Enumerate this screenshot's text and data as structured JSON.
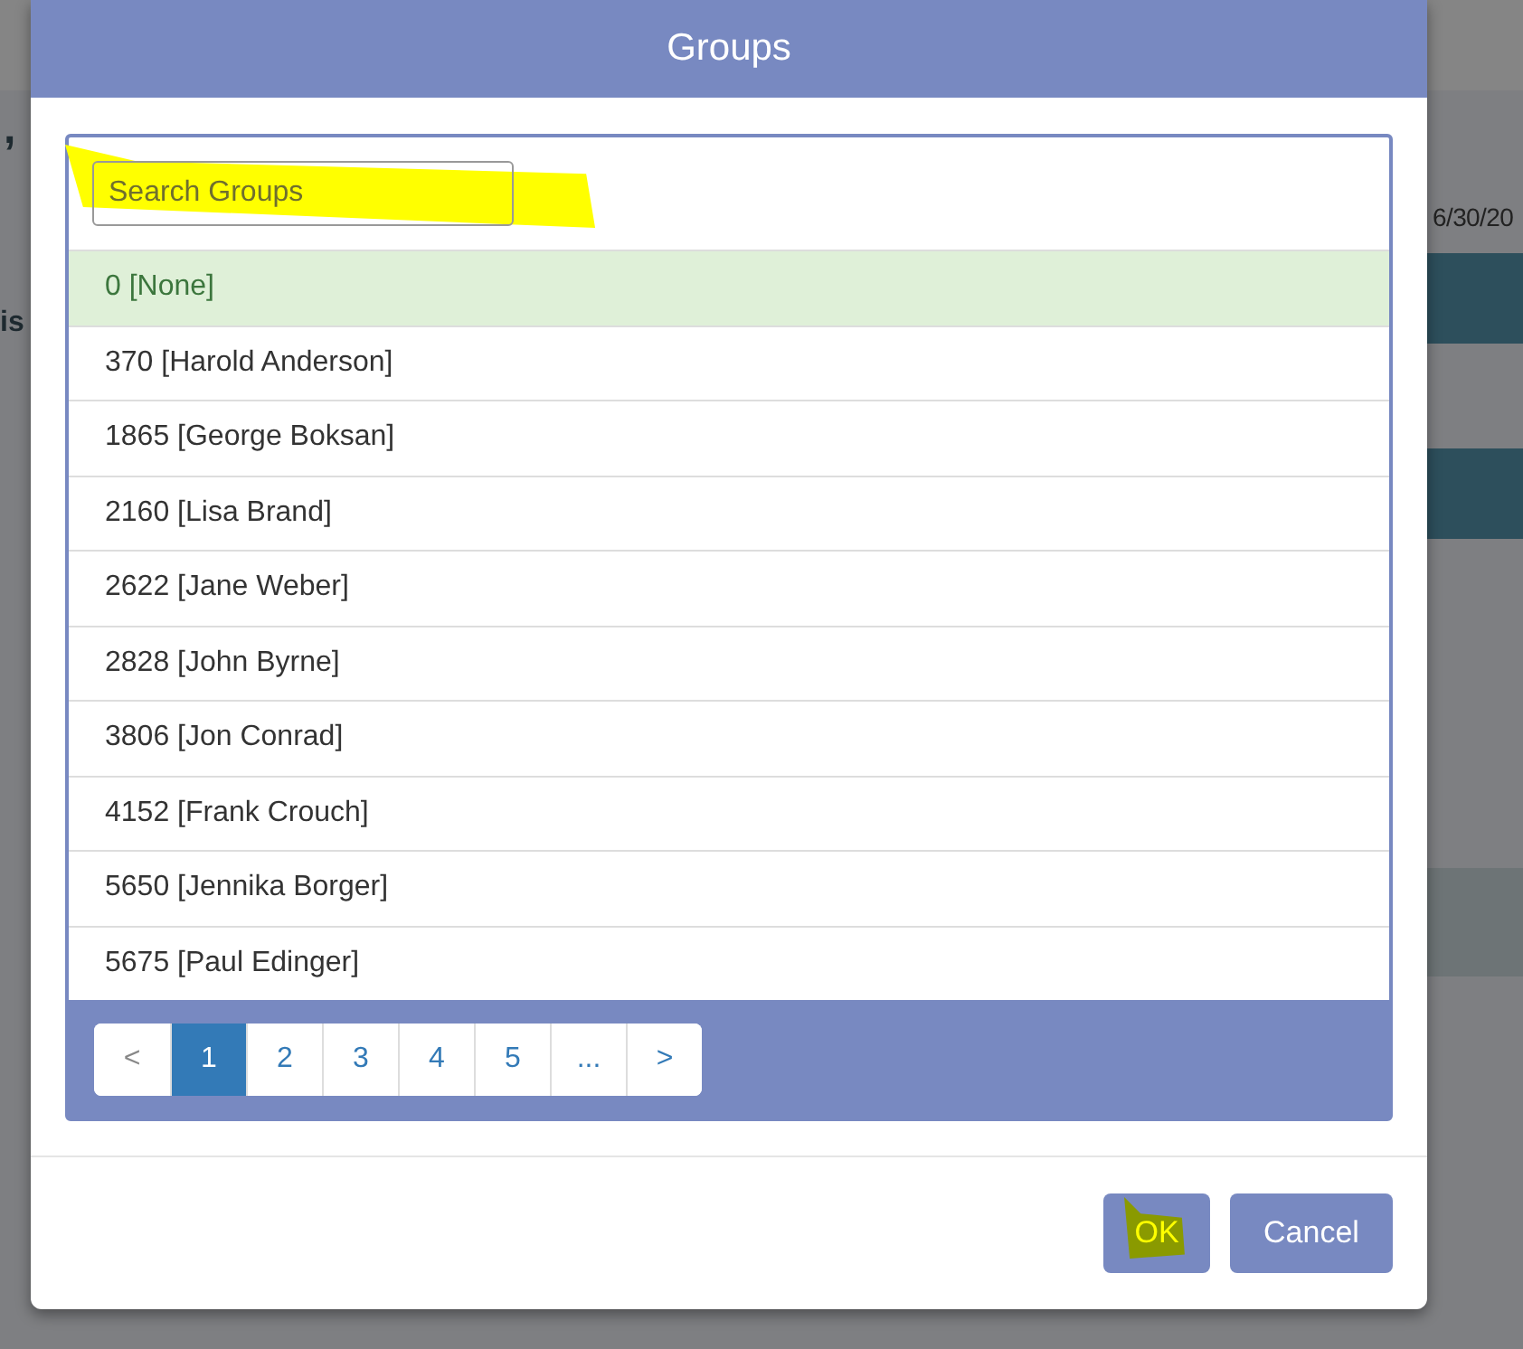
{
  "background": {
    "fragments": [
      ",",
      "is"
    ],
    "date": "6/30/20"
  },
  "dialog": {
    "title": "Groups",
    "search": {
      "placeholder": "Search Groups"
    },
    "groups": [
      {
        "label": "0 [None]",
        "selected": true
      },
      {
        "label": "370 [Harold Anderson]",
        "selected": false
      },
      {
        "label": "1865 [George Boksan]",
        "selected": false
      },
      {
        "label": "2160 [Lisa Brand]",
        "selected": false
      },
      {
        "label": "2622 [Jane Weber]",
        "selected": false
      },
      {
        "label": "2828 [John Byrne]",
        "selected": false
      },
      {
        "label": "3806 [Jon Conrad]",
        "selected": false
      },
      {
        "label": "4152 [Frank Crouch]",
        "selected": false
      },
      {
        "label": "5650 [Jennika Borger]",
        "selected": false
      },
      {
        "label": "5675 [Paul Edinger]",
        "selected": false
      }
    ],
    "pagination": [
      {
        "label": "<",
        "selected": false
      },
      {
        "label": "1",
        "selected": true
      },
      {
        "label": "2",
        "selected": false
      },
      {
        "label": "3",
        "selected": false
      },
      {
        "label": "4",
        "selected": false
      },
      {
        "label": "5",
        "selected": false
      },
      {
        "label": "...",
        "selected": false
      },
      {
        "label": ">",
        "selected": false
      }
    ],
    "buttons": [
      {
        "label": "OK",
        "kind": "primary"
      },
      {
        "label": "Cancel",
        "kind": "secondary"
      }
    ]
  }
}
